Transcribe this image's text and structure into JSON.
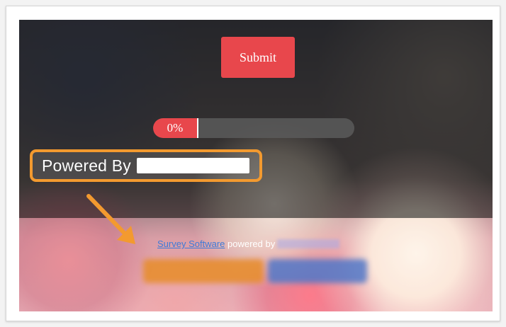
{
  "form": {
    "submit_label": "Submit",
    "progress": {
      "percent": 0,
      "label": "0%"
    }
  },
  "callout": {
    "text": "Powered By",
    "border_color": "#f39a2f"
  },
  "footer": {
    "link_text": "Survey Software",
    "suffix_text": " powered by"
  },
  "colors": {
    "accent": "#e8474c",
    "link": "#3e7ad8",
    "annotation": "#f39a2f"
  }
}
